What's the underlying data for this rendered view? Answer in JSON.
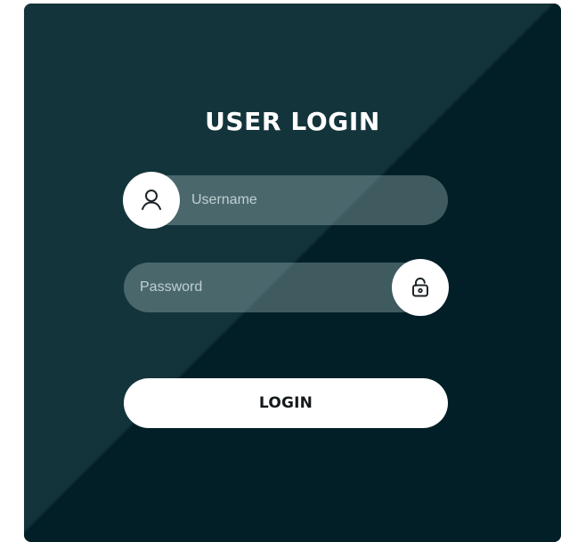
{
  "login": {
    "title": "USER LOGIN",
    "username": {
      "placeholder": "Username",
      "icon": "user-icon"
    },
    "password": {
      "placeholder": "Password",
      "icon": "lock-icon"
    },
    "button_label": "LOGIN"
  },
  "colors": {
    "background": "#0f2b33",
    "accent": "#ffffff"
  }
}
